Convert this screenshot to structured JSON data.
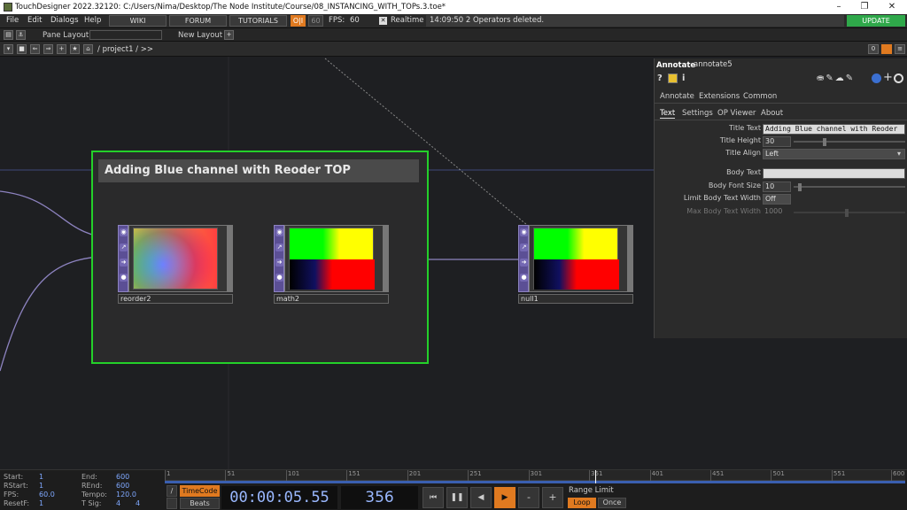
{
  "window": {
    "title": "TouchDesigner 2022.32120: C:/Users/Nima/Desktop/The Node Institute/Course/08_INSTANCING_WITH_TOPs.3.toe*"
  },
  "menu": {
    "items": [
      "File",
      "Edit",
      "Dialogs",
      "Help"
    ],
    "wiki": "WIKI",
    "forum": "FORUM",
    "tutorials": "TUTORIALS",
    "oi": "O|I",
    "fps_target": "60",
    "fps_label": "FPS:",
    "fps_value": "60",
    "realtime": "Realtime",
    "status": "14:09:50 2 Operators deleted.",
    "update": "UPDATE"
  },
  "toolbar": {
    "pane_layout": "Pane Layout",
    "new_layout": "New Layout"
  },
  "path": {
    "text": "/ project1 / >>",
    "badge": "0"
  },
  "annotation": {
    "title": "Adding Blue channel with Reoder TOP"
  },
  "nodes": [
    {
      "label": "reorder2"
    },
    {
      "label": "math2"
    },
    {
      "label": "null1"
    }
  ],
  "param": {
    "type": "Annotate",
    "name": "annotate5",
    "tabs_top": [
      "Annotate",
      "Extensions",
      "Common"
    ],
    "tabs_sub": [
      "Text",
      "Settings",
      "OP Viewer",
      "About"
    ],
    "rows": [
      {
        "label": "Title Text",
        "value": "Adding Blue channel with Reoder"
      },
      {
        "label": "Title Height",
        "value": "30"
      },
      {
        "label": "Title Align",
        "value": "Left"
      },
      {
        "label": "Body Text",
        "value": ""
      },
      {
        "label": "Body Font Size",
        "value": "10"
      },
      {
        "label": "Limit Body Text Width",
        "value": "Off"
      },
      {
        "label": "Max Body Text Width",
        "value": "1000"
      }
    ]
  },
  "timeline": {
    "start_label": "Start:",
    "start": "1",
    "rstart_label": "RStart:",
    "rstart": "1",
    "fps_label": "FPS:",
    "fps": "60.0",
    "resetf_label": "ResetF:",
    "resetf": "1",
    "end_label": "End:",
    "end": "600",
    "rend_label": "REnd:",
    "rend": "600",
    "tempo_label": "Tempo:",
    "tempo": "120.0",
    "tsig_label": "T Sig:",
    "tsig_a": "4",
    "tsig_b": "4",
    "ticks": [
      "1",
      "51",
      "101",
      "151",
      "201",
      "251",
      "301",
      "351",
      "401",
      "451",
      "501",
      "551",
      "600"
    ],
    "timecode_btn": "TimeCode",
    "beats_btn": "Beats",
    "timecode": "00:00:05.55",
    "frame": "356",
    "range_limit": "Range Limit",
    "loop": "Loop",
    "once": "Once",
    "playhead_frame": 356
  }
}
